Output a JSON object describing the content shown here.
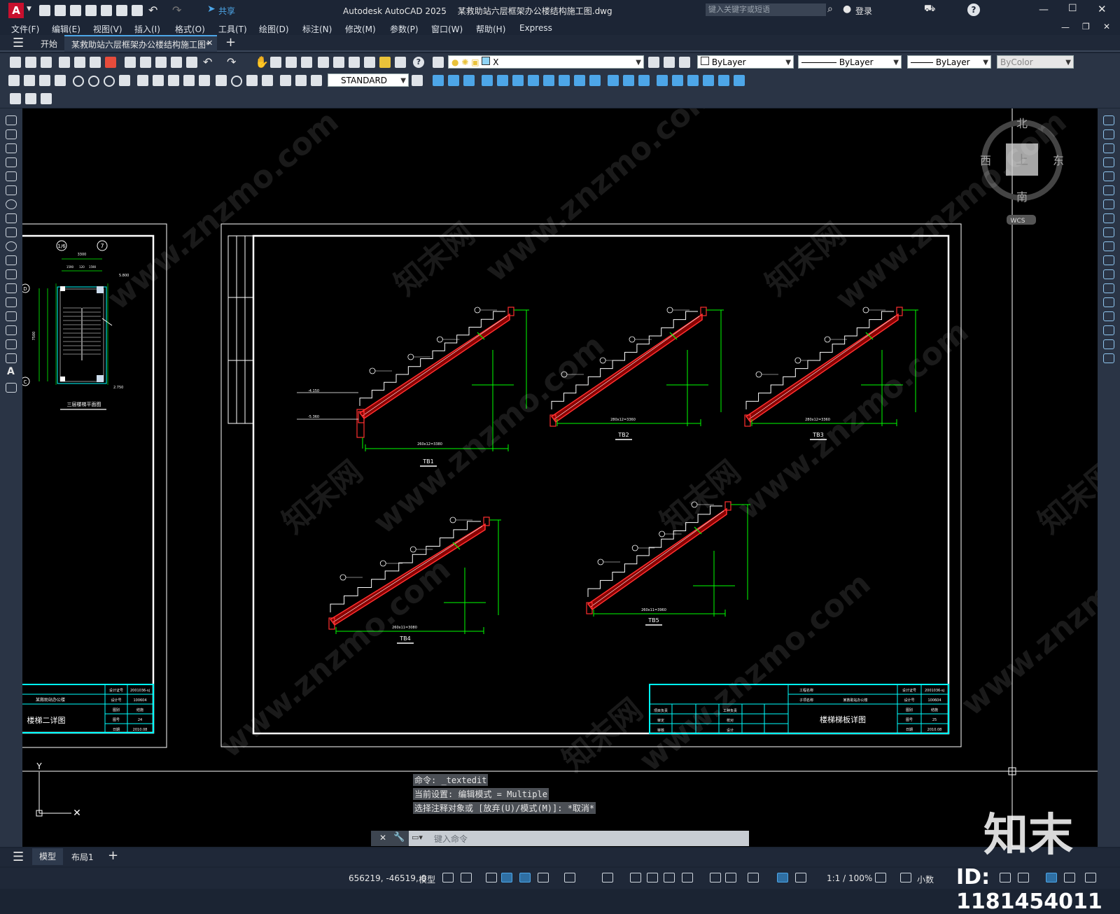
{
  "app": {
    "name": "Autodesk AutoCAD 2025",
    "file": "某救助站六层框架办公楼结构施工图.dwg",
    "logo_letter": "A"
  },
  "titlebar": {
    "share": "共享",
    "search_placeholder": "键入关键字或短语",
    "login": "登录"
  },
  "menu": [
    "文件(F)",
    "编辑(E)",
    "视图(V)",
    "插入(I)",
    "格式(O)",
    "工具(T)",
    "绘图(D)",
    "标注(N)",
    "修改(M)",
    "参数(P)",
    "窗口(W)",
    "帮助(H)",
    "Express"
  ],
  "tabs": {
    "start": "开始",
    "doc": "某救助站六层框架办公楼结构施工图*"
  },
  "toolbar": {
    "layer_name": "X",
    "color": "ByLayer",
    "linetype": "ByLayer",
    "lineweight": "ByLayer",
    "plotstyle": "ByColor",
    "textstyle": "STANDARD"
  },
  "viewcube": {
    "north": "北",
    "south": "南",
    "east": "东",
    "west": "西",
    "top": "上",
    "wcs": "WCS"
  },
  "left_sheet": {
    "grid_labels": [
      "1/6",
      "7",
      "D",
      "C"
    ],
    "dims": [
      "3300",
      "1590",
      "120",
      "1590",
      "7500",
      "5.800",
      "2.750"
    ],
    "caption": "三层楼梯平面图",
    "titleblock": {
      "title": "楼梯二详图",
      "rows": [
        [
          "设计证号",
          "2001036-sj"
        ],
        [
          "设计号",
          "100604"
        ],
        [
          "图别",
          "结施"
        ],
        [
          "图号",
          "24"
        ],
        [
          "日期",
          "2010.08"
        ]
      ],
      "project": "某救助站办公楼"
    }
  },
  "main_sheet": {
    "stairs": [
      "TB1",
      "TB2",
      "TB3",
      "TB4",
      "TB5"
    ],
    "dims": {
      "tb1_run": "260x12=3380",
      "tb2_run": "280x12=3360",
      "tb3_run": "280x12=3360",
      "tb4_run": "260x11=3080",
      "tb5_run": "260x11=3960",
      "tb1_elev": [
        "-4.150",
        "-5.360"
      ]
    },
    "titleblock": {
      "title": "楼梯梯板详图",
      "project_label": "工程名称",
      "item_label": "子项名称",
      "item": "某救助站办公楼",
      "rows": [
        [
          "设计证号",
          "2001036-sj"
        ],
        [
          "设计号",
          "100604"
        ],
        [
          "图别",
          "结施"
        ],
        [
          "图号",
          "25"
        ],
        [
          "日期",
          "2010.08"
        ]
      ],
      "roles": [
        "项目负责",
        "审定",
        "审核",
        "工种负责",
        "校对",
        "设计"
      ]
    }
  },
  "command": {
    "lines": [
      "命令: _textedit",
      "当前设置: 编辑模式 = Multiple",
      "选择注释对象或 [放弃(U)/模式(M)]: *取消*"
    ],
    "placeholder": "键入命令"
  },
  "layout_tabs": {
    "model": "模型",
    "layout": "布局1"
  },
  "status": {
    "coords": "656219, -46519, 0",
    "model": "模型",
    "scale": "1:1 / 100%",
    "units": "小数"
  },
  "watermark": {
    "site": "www.znzmo.com",
    "brand_cn": "知末网",
    "logo": "知末",
    "id": "ID: 1181454011"
  }
}
